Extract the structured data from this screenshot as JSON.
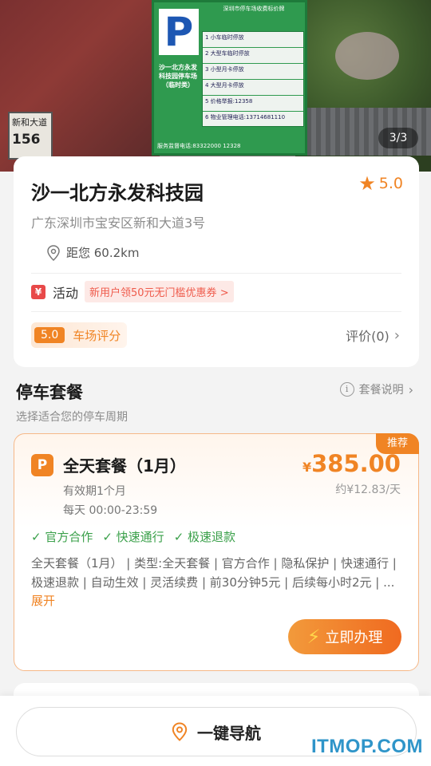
{
  "hero": {
    "counter": "3/3",
    "sign": {
      "p_letter": "P",
      "header": "深圳市停车场收费标价牌",
      "side_title": "沙一北方永发科技园停车场（临时类）",
      "rows": [
        "1  小车临时停放",
        "2  大型车临时停放",
        "3  小型月卡停放",
        "4  大型月卡停放",
        "5  价格举报:12358",
        "6  物业管理电话:13714681110"
      ],
      "footer": "服务监督电话:83322000  12328"
    },
    "street_plate": {
      "name": "新和大道",
      "number": "156"
    }
  },
  "park": {
    "name": "沙一北方永发科技园",
    "rating": "5.0",
    "address": "广东深圳市宝安区新和大道3号",
    "distance": "距您 60.2km",
    "activity_label": "活动",
    "activity_icon": "¥",
    "coupon": "新用户领50元无门槛优惠券 >",
    "score": "5.0",
    "score_label": "车场评分",
    "reviews": "评价(0)"
  },
  "section": {
    "title": "停车套餐",
    "subtitle": "选择适合您的停车周期",
    "help": "套餐说明"
  },
  "package": {
    "badge": "推荐",
    "icon_letter": "P",
    "name": "全天套餐（1月）",
    "currency": "¥",
    "price": "385.00",
    "per_day": "约¥12.83/天",
    "validity": "有效期1个月",
    "hours": "每天 00:00-23:59",
    "features": [
      "✓ 官方合作",
      "✓ 快速通行",
      "✓ 极速退款"
    ],
    "description": "全天套餐（1月） | 类型:全天套餐 | 官方合作 | 隐私保护 | 快速通行 | 极速退款 | 自动生效 | 灵活续费 | 前30分钟5元 | 后续每小时2元 | ...",
    "expand": "展开",
    "apply": "立即办理"
  },
  "bottom": {
    "navigate": "一键导航"
  },
  "watermark": "ITMOP.COM",
  "colors": {
    "accent": "#f08424",
    "green": "#3aa04a",
    "coupon_red": "#ef5b4c"
  }
}
